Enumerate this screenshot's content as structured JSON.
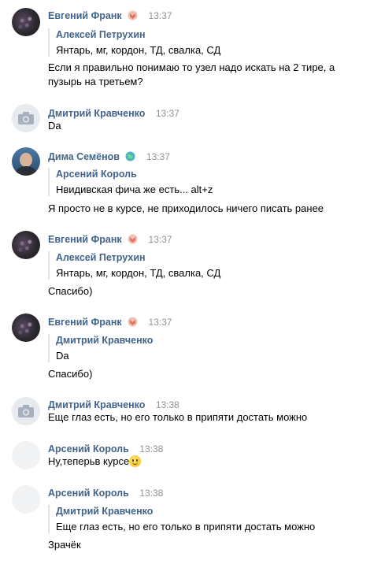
{
  "messages": [
    {
      "author": "Евгений Франк",
      "badge": "ribbon-badge",
      "time": "13:37",
      "quote": {
        "author": "Алексей Петрухин",
        "text": "Янтарь, мг, кордон, ТД, свалка, СД"
      },
      "text": "Если я правильно понимаю то узел надо искать на 2 тире, а пузырь на третьем?"
    },
    {
      "author": "Дмитрий Кравченко",
      "time": "13:37",
      "text": "Da"
    },
    {
      "author": "Дима Семёнов",
      "badge": "globe-badge",
      "time": "13:37",
      "quote": {
        "author": "Арсений Король",
        "text": "Нвидивская фича же есть... alt+z"
      },
      "text": "Я просто не в курсе, не приходилось ничего писать ранее"
    },
    {
      "author": "Евгений Франк",
      "badge": "ribbon-badge",
      "time": "13:37",
      "quote": {
        "author": "Алексей Петрухин",
        "text": "Янтарь, мг, кордон, ТД, свалка, СД"
      },
      "text": "Спасибо)"
    },
    {
      "author": "Евгений Франк",
      "badge": "ribbon-badge",
      "time": "13:37",
      "quote": {
        "author": "Дмитрий Кравченко",
        "text": "Da"
      },
      "text": "Спасибо)"
    },
    {
      "author": "Дмитрий Кравченко",
      "time": "13:38",
      "text": "Еще глаз есть, но его только в припяти достать можно"
    },
    {
      "author": "Арсений Король",
      "time": "13:38",
      "text": "Ну,теперьв курсе",
      "emoji": "smiling-face-emoji"
    },
    {
      "author": "Арсений Король",
      "time": "13:38",
      "quote": {
        "author": "Дмитрий Кравченко",
        "text": "Еще глаз есть, но его только в припяти достать можно"
      },
      "text": "Зрачёк"
    }
  ]
}
